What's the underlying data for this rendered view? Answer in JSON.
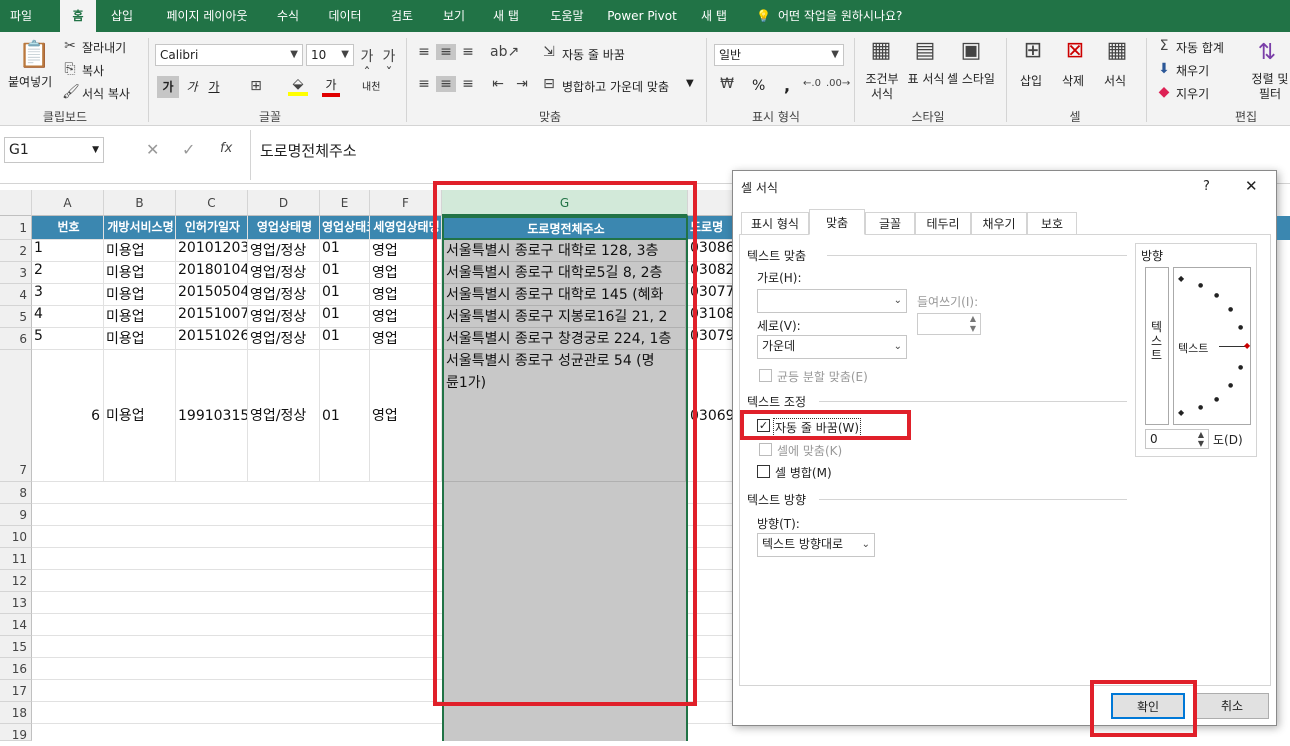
{
  "tabs": [
    {
      "label": "파일"
    },
    {
      "label": "홈"
    },
    {
      "label": "삽입"
    },
    {
      "label": "페이지 레이아웃"
    },
    {
      "label": "수식"
    },
    {
      "label": "데이터"
    },
    {
      "label": "검토"
    },
    {
      "label": "보기"
    },
    {
      "label": "새 탭"
    },
    {
      "label": "도움말"
    },
    {
      "label": "Power Pivot"
    },
    {
      "label": "새 탭"
    }
  ],
  "tell_me": "어떤 작업을 원하시나요?",
  "ribbon": {
    "paste": "붙여넣기",
    "cut": "잘라내기",
    "copy": "복사",
    "format_painter": "서식 복사",
    "clipboard": "클립보드",
    "font_name": "Calibri",
    "font_size": "10",
    "bold": "가",
    "italic": "가",
    "underline": "가",
    "font_color": "가",
    "phonetic": "내천",
    "font_group": "글꼴",
    "wrap_text": "자동 줄 바꿈",
    "merge_center": "병합하고 가운데 맞춤",
    "align_group": "맞춤",
    "number_format": "일반",
    "percent": "%",
    "comma": ",",
    "number_group": "표시 형식",
    "cond_format": "조건부 서식",
    "table_format": "표 서식",
    "cell_style": "셀 스타일",
    "style_group": "스타일",
    "insert": "삽입",
    "delete": "삭제",
    "format": "서식",
    "cells_group": "셀",
    "autosum": "자동 합계",
    "fill": "채우기",
    "clear": "지우기",
    "sort_filter": "정렬 및 필터",
    "edit_group": "편집"
  },
  "formula_bar": {
    "name_box": "G1",
    "fx": "fx",
    "content": "도로명전체주소"
  },
  "columns": [
    "A",
    "B",
    "C",
    "D",
    "E",
    "F",
    "G"
  ],
  "headers": [
    "번호",
    "개방서비스명",
    "인허가일자",
    "영업상태명",
    "영업상태코드",
    "세영업상태명",
    "도로명전체주소",
    "도로명"
  ],
  "rows": [
    {
      "n": "1",
      "b": "미용업",
      "c": "20101203",
      "d": "영업/정상",
      "e": "01",
      "f": "영업",
      "g": "서울특별시 종로구 대학로 128, 3층",
      "h": "03086"
    },
    {
      "n": "2",
      "b": "미용업",
      "c": "20180104",
      "d": "영업/정상",
      "e": "01",
      "f": "영업",
      "g": "서울특별시 종로구 대학로5길 8, 2층",
      "h": "03082"
    },
    {
      "n": "3",
      "b": "미용업",
      "c": "20150504",
      "d": "영업/정상",
      "e": "01",
      "f": "영업",
      "g": "서울특별시 종로구 대학로 145 (혜화",
      "h": "03077"
    },
    {
      "n": "4",
      "b": "미용업",
      "c": "20151007",
      "d": "영업/정상",
      "e": "01",
      "f": "영업",
      "g": "서울특별시 종로구 지봉로16길 21, 2",
      "h": "03108"
    },
    {
      "n": "5",
      "b": "미용업",
      "c": "20151026",
      "d": "영업/정상",
      "e": "01",
      "f": "영업",
      "g": "서울특별시 종로구 창경궁로 224, 1층",
      "h": "03079"
    },
    {
      "n": "6",
      "b": "미용업",
      "c": "19910315",
      "d": "영업/정상",
      "e": "01",
      "f": "영업",
      "g1": "서울특별시 종로구 성균관로 54 (명",
      "g2": "륜1가)",
      "h": "03069"
    }
  ],
  "row_numbers": [
    "1",
    "2",
    "3",
    "4",
    "5",
    "6",
    "7",
    "8",
    "9",
    "10",
    "11",
    "12",
    "13",
    "14",
    "15",
    "16",
    "17",
    "18",
    "19"
  ],
  "dialog": {
    "title": "셀 서식",
    "help": "?",
    "close": "✕",
    "tabs": [
      "표시 형식",
      "맞춤",
      "글꼴",
      "테두리",
      "채우기",
      "보호"
    ],
    "text_align": "텍스트 맞춤",
    "horizontal": "가로(H):",
    "horizontal_value": "",
    "indent": "들여쓰기(I):",
    "vertical": "세로(V):",
    "vertical_value": "가운데",
    "justify_distributed": "균등 분할 맞춤(E)",
    "text_control": "텍스트 조정",
    "wrap_text": "자동 줄 바꿈(W)",
    "shrink": "셀에 맞춤(K)",
    "merge": "셀 병합(M)",
    "direction_section": "텍스트 방향",
    "direction": "방향(T):",
    "direction_value": "텍스트 방향대로",
    "orientation": "방향",
    "vertical_text": "텍스트",
    "orient_text": "텍스트",
    "degrees_value": "0",
    "degrees": "도(D)",
    "ok": "확인",
    "cancel": "취소"
  }
}
